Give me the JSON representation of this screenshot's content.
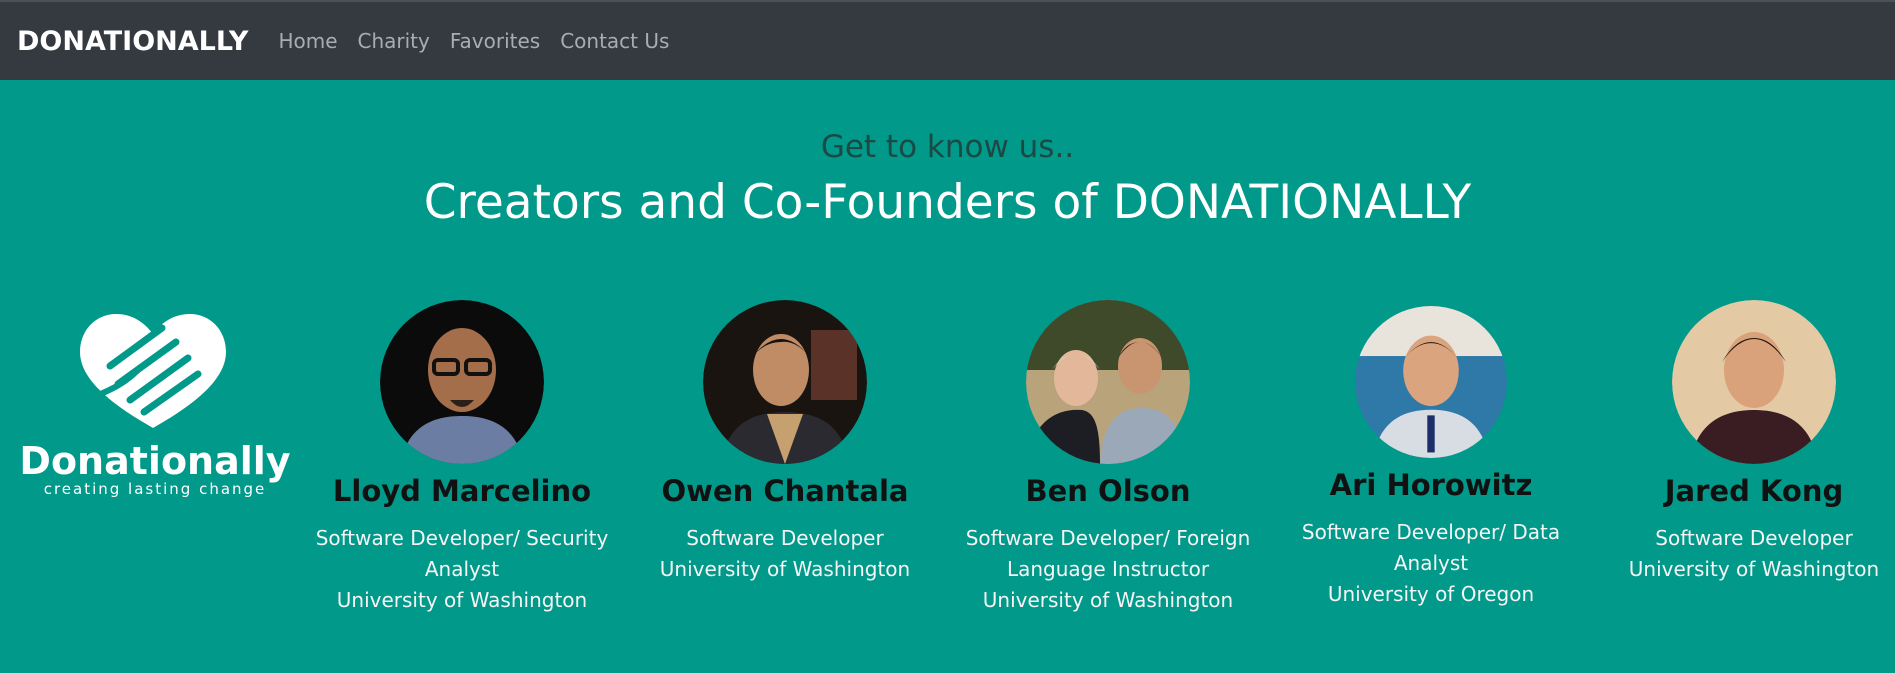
{
  "nav": {
    "brand": "DONATIONALLY",
    "links": [
      "Home",
      "Charity",
      "Favorites",
      "Contact Us"
    ]
  },
  "intro": {
    "subtitle": "Get to know us..",
    "title": "Creators and Co-Founders of DONATIONALLY"
  },
  "logo": {
    "name": "Donationally",
    "tagline": "creating lasting change"
  },
  "team": [
    {
      "name": "Lloyd Marcelino",
      "role": "Software Developer/ Security Analyst",
      "school": "University of Washington"
    },
    {
      "name": "Owen Chantala",
      "role": "Software Developer",
      "school": "University of Washington"
    },
    {
      "name": "Ben Olson",
      "role": "Software Developer/ Foreign Language Instructor",
      "school": "University of Washington"
    },
    {
      "name": "Ari Horowitz",
      "role": "Software Developer/ Data Analyst",
      "school": "University of Oregon"
    },
    {
      "name": "Jared Kong",
      "role": "Software Developer",
      "school": "University of Washington"
    }
  ],
  "colors": {
    "background": "#00998a",
    "navbar": "#343a40"
  }
}
